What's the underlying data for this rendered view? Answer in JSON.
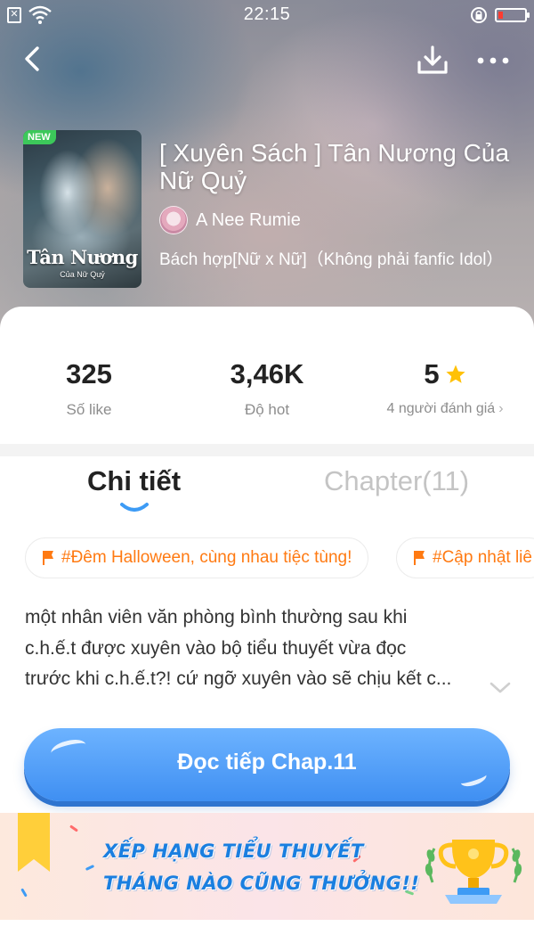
{
  "status_bar": {
    "time": "22:15",
    "sim_icon": "sim-card-icon",
    "wifi_icon": "wifi-icon",
    "battery_color": "#ff3b30"
  },
  "nav": {
    "back_icon": "chevron-left-icon",
    "download_icon": "download-icon",
    "more_icon": "more-dots-icon"
  },
  "book": {
    "badge": "NEW",
    "cover_title": "Tân Nương",
    "cover_subtitle": "Của Nữ Quỷ",
    "title": "[ Xuyên Sách ] Tân Nương Của Nữ Quỷ",
    "author": "A Nee Rumie",
    "genre": "Bách hợp[Nữ x Nữ]（Không phải fanfic Idol）"
  },
  "stats": {
    "likes_value": "325",
    "likes_label": "Số like",
    "hot_value": "3,46K",
    "hot_label": "Độ hot",
    "rating_value": "5",
    "rating_label": "4 người đánh giá",
    "star_color": "#ffc107"
  },
  "tabs": {
    "detail": "Chi tiết",
    "chapter": "Chapter(11)",
    "active": "detail",
    "indicator_color": "#3d9bf5"
  },
  "tags": [
    {
      "label": "#Đêm Halloween, cùng nhau tiệc tùng!"
    },
    {
      "label": "#Cập nhật liê"
    }
  ],
  "description": {
    "line1": "một nhân viên văn phòng bình thường sau khi",
    "line2": "c.h.ế.t được xuyên vào bộ tiểu thuyết vừa đọc",
    "line3": "trước khi c.h.ế.t?!  cứ ngỡ xuyên vào sẽ chịu kết c..."
  },
  "read_button": {
    "label": "Đọc tiếp Chap.11",
    "color": "#4a98f5"
  },
  "banner": {
    "line1": "XẾP HẠNG TIỂU THUYẾT",
    "line2": "THÁNG NÀO CŨNG THƯỞNG!!",
    "text_color": "#1a7fe0",
    "trophy_icon": "trophy-icon"
  },
  "accent_color": "#ff7a12"
}
